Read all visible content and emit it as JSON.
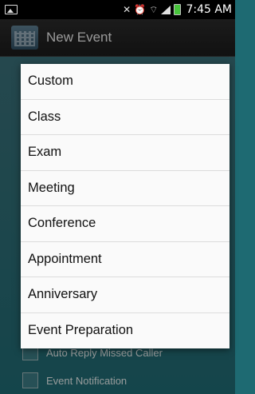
{
  "status_bar": {
    "time": "7:45 AM"
  },
  "title_bar": {
    "title": "New Event"
  },
  "dropdown": {
    "options": [
      "Custom",
      "Class",
      "Exam",
      "Meeting",
      "Conference",
      "Appointment",
      "Anniversary",
      "Event Preparation"
    ]
  },
  "background": {
    "rows": [
      {
        "label": "Auto Reply Missed Caller"
      },
      {
        "label": "Event Notification"
      }
    ]
  }
}
